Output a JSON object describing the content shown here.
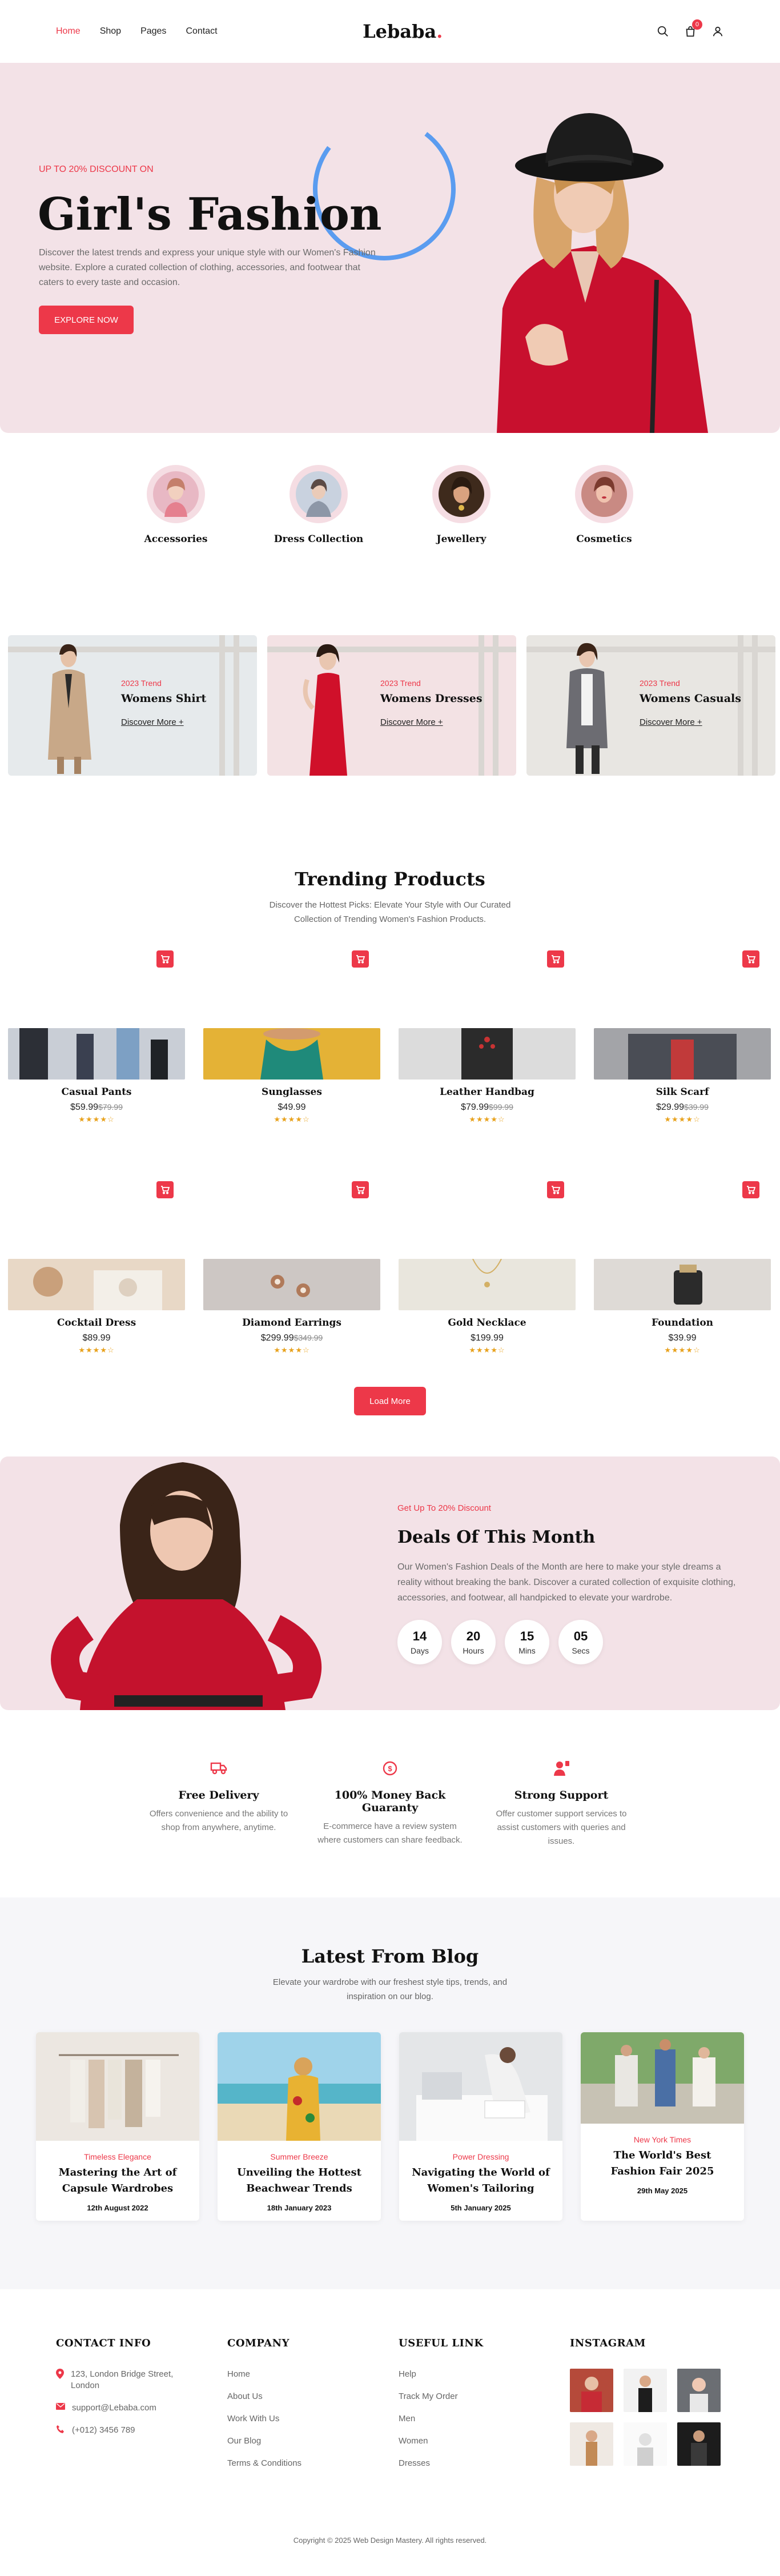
{
  "nav": {
    "links": [
      "Home",
      "Shop",
      "Pages",
      "Contact"
    ],
    "logo": "Lebaba",
    "logo_dot": ".",
    "cart_count": "0",
    "accent": "#ed3849"
  },
  "hero": {
    "subtitle": "UP TO 20% DISCOUNT ON",
    "title": "Girl's Fashion",
    "text": "Discover the latest trends and express your unique style with our Women's Fashion website. Explore a curated collection of clothing, accessories, and footwear that caters to every taste and occasion.",
    "button": "EXPLORE NOW",
    "background": "#f3e2e7",
    "ring_color": "#5a9cf0"
  },
  "categories": [
    {
      "label": "Accessories"
    },
    {
      "label": "Dress Collection"
    },
    {
      "label": "Jewellery"
    },
    {
      "label": "Cosmetics"
    }
  ],
  "banners": [
    {
      "trend": "2023 Trend",
      "title": "Womens Shirt",
      "link": "Discover More +"
    },
    {
      "trend": "2023 Trend",
      "title": "Womens Dresses",
      "link": "Discover More +"
    },
    {
      "trend": "2023 Trend",
      "title": "Womens Casuals",
      "link": "Discover More +"
    }
  ],
  "trending": {
    "title": "Trending Products",
    "description": "Discover the Hottest Picks: Elevate Your Style with Our Curated Collection of Trending Women's Fashion Products.",
    "products": [
      {
        "name": "Casual Pants",
        "price": "$59.99",
        "old_price": "$79.99",
        "rating": 4
      },
      {
        "name": "Sunglasses",
        "price": "$49.99",
        "old_price": "",
        "rating": 4
      },
      {
        "name": "Leather Handbag",
        "price": "$79.99",
        "old_price": "$99.99",
        "rating": 4
      },
      {
        "name": "Silk Scarf",
        "price": "$29.99",
        "old_price": "$39.99",
        "rating": 4
      },
      {
        "name": "Cocktail Dress",
        "price": "$89.99",
        "old_price": "",
        "rating": 4
      },
      {
        "name": "Diamond Earrings",
        "price": "$299.99",
        "old_price": "$349.99",
        "rating": 4
      },
      {
        "name": "Gold Necklace",
        "price": "$199.99",
        "old_price": "",
        "rating": 4
      },
      {
        "name": "Foundation",
        "price": "$39.99",
        "old_price": "",
        "rating": 4
      }
    ],
    "load_more": "Load More"
  },
  "deals": {
    "subtitle": "Get Up To 20% Discount",
    "title": "Deals Of This Month",
    "text": "Our Women's Fashion Deals of the Month are here to make your style dreams a reality without breaking the bank. Discover a curated collection of exquisite clothing, accessories, and footwear, all handpicked to elevate your wardrobe.",
    "timer": [
      {
        "value": "14",
        "label": "Days"
      },
      {
        "value": "20",
        "label": "Hours"
      },
      {
        "value": "15",
        "label": "Mins"
      },
      {
        "value": "05",
        "label": "Secs"
      }
    ]
  },
  "features": [
    {
      "icon": "truck-icon",
      "title": "Free Delivery",
      "text": "Offers convenience and the ability to shop from anywhere, anytime."
    },
    {
      "icon": "money-icon",
      "title": "100% Money Back Guaranty",
      "text": "E-commerce have a review system where customers can share feedback."
    },
    {
      "icon": "support-icon",
      "title": "Strong Support",
      "text": "Offer customer support services to assist customers with queries and issues."
    }
  ],
  "blog": {
    "title": "Latest From Blog",
    "description": "Elevate your wardrobe with our freshest style tips, trends, and inspiration on our blog.",
    "posts": [
      {
        "tag": "Timeless Elegance",
        "title": "Mastering the Art of Capsule Wardrobes",
        "date": "12th August 2022"
      },
      {
        "tag": "Summer Breeze",
        "title": "Unveiling the Hottest Beachwear Trends",
        "date": "18th January 2023"
      },
      {
        "tag": "Power Dressing",
        "title": "Navigating the World of Women's Tailoring",
        "date": "5th January 2025"
      },
      {
        "tag": "New York Times",
        "title": "The World's Best Fashion Fair 2025",
        "date": "29th May 2025"
      }
    ]
  },
  "footer": {
    "contact_title": "CONTACT INFO",
    "contact": [
      {
        "icon": "map-pin-icon",
        "text": "123, London Bridge Street, London"
      },
      {
        "icon": "mail-icon",
        "text": "support@Lebaba.com"
      },
      {
        "icon": "phone-icon",
        "text": "(+012) 3456 789"
      }
    ],
    "company_title": "COMPANY",
    "company": [
      "Home",
      "About Us",
      "Work With Us",
      "Our Blog",
      "Terms & Conditions"
    ],
    "useful_title": "USEFUL LINK",
    "useful": [
      "Help",
      "Track My Order",
      "Men",
      "Women",
      "Dresses"
    ],
    "instagram_title": "INSTAGRAM",
    "copyright": "Copyright © 2025 Web Design Mastery. All rights reserved."
  }
}
